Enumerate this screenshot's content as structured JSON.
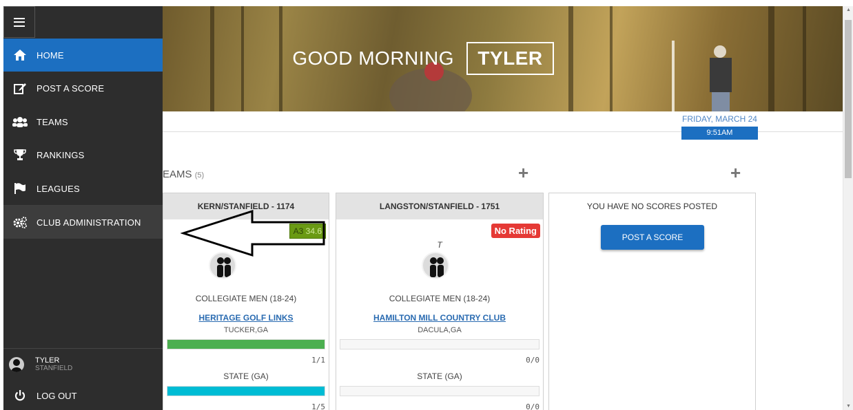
{
  "hero": {
    "greeting": "GOOD MORNING",
    "user_name": "TYLER"
  },
  "datetime": {
    "date": "FRIDAY, MARCH 24",
    "time": "9:51AM"
  },
  "sidebar": {
    "items": [
      {
        "label": "HOME",
        "icon": "home-icon"
      },
      {
        "label": "POST A SCORE",
        "icon": "edit-icon"
      },
      {
        "label": "TEAMS",
        "icon": "users-icon"
      },
      {
        "label": "RANKINGS",
        "icon": "trophy-icon"
      },
      {
        "label": "LEAGUES",
        "icon": "flag-icon"
      },
      {
        "label": "CLUB ADMINISTRATION",
        "icon": "gears-icon"
      }
    ],
    "user": {
      "first_name": "TYLER",
      "last_name": "STANFIELD"
    },
    "logout_label": "LOG OUT"
  },
  "teams_section": {
    "title_visible": "EAMS",
    "count": "(5)"
  },
  "cards": [
    {
      "title": "KERN/STANFIELD - 1174",
      "rating_label": "A3",
      "rating_value": "34.6",
      "division": "COLLEGIATE MEN (18-24)",
      "course": "HERITAGE GOLF LINKS",
      "location": "TUCKER,GA",
      "progress1": "1/1",
      "progress1_fraction": 1.0,
      "state": "STATE (GA)",
      "progress2": "1/5",
      "progress2_fraction": 1.0
    },
    {
      "title": "LANGSTON/STANFIELD - 1751",
      "rating_label": "No Rating",
      "marker": "T",
      "division": "COLLEGIATE MEN (18-24)",
      "course": "HAMILTON MILL COUNTRY CLUB",
      "location": "DACULA,GA",
      "progress1": "0/0",
      "progress1_fraction": 0,
      "state": "STATE (GA)",
      "progress2": "0/0",
      "progress2_fraction": 0
    }
  ],
  "scores_card": {
    "message": "YOU HAVE NO SCORES POSTED",
    "button_label": "POST A SCORE"
  },
  "colors": {
    "primary": "#1c6fc1",
    "sidebar": "#2d2d2d",
    "green": "#4caf50",
    "teal": "#00bcd4",
    "danger": "#e53935"
  }
}
